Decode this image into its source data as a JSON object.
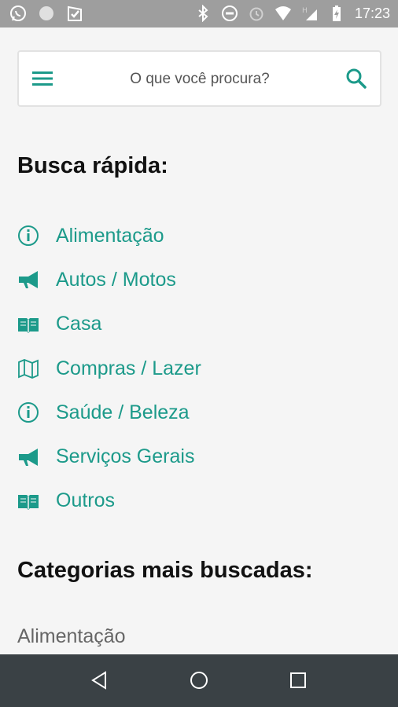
{
  "status_bar": {
    "time": "17:23",
    "left_icons": [
      "whatsapp-icon",
      "circle-notification-icon",
      "check-flag-icon"
    ],
    "right_icons": [
      "bluetooth-icon",
      "do-not-disturb-icon",
      "alarm-icon",
      "wifi-icon",
      "signal-h-icon",
      "battery-charging-icon"
    ]
  },
  "search": {
    "placeholder": "O que você procura?",
    "menu_icon": "hamburger-menu-icon",
    "search_icon": "search-icon"
  },
  "quick_search": {
    "title": "Busca rápida:",
    "items": [
      {
        "label": "Alimentação",
        "icon": "info-circle-icon"
      },
      {
        "label": "Autos / Motos",
        "icon": "megaphone-icon"
      },
      {
        "label": "Casa",
        "icon": "open-book-icon"
      },
      {
        "label": "Compras / Lazer",
        "icon": "map-icon"
      },
      {
        "label": "Saúde / Beleza",
        "icon": "info-circle-icon"
      },
      {
        "label": "Serviços Gerais",
        "icon": "megaphone-icon"
      },
      {
        "label": "Outros",
        "icon": "open-book-icon"
      }
    ]
  },
  "categories": {
    "title": "Categorias mais buscadas:",
    "items": [
      "Alimentação"
    ]
  },
  "colors": {
    "accent": "#1c9a8a",
    "status_bar": "#9e9e9e",
    "nav_bar": "#3a4145"
  },
  "nav_bar": {
    "back_icon": "back-triangle-icon",
    "home_icon": "home-circle-icon",
    "recent_icon": "recent-apps-square-icon"
  }
}
